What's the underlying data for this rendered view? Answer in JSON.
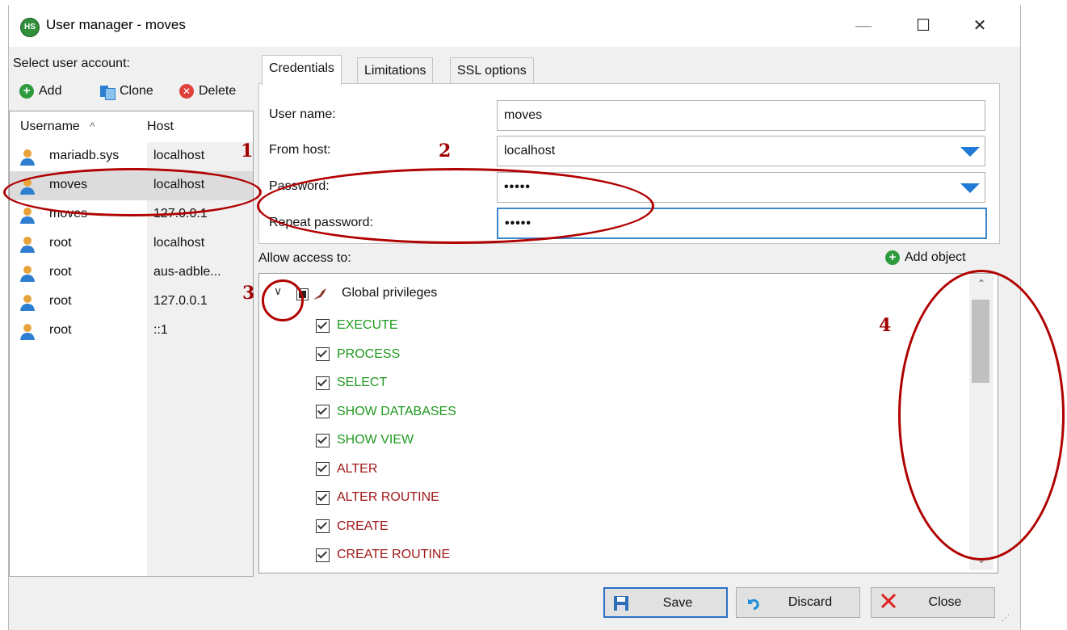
{
  "window": {
    "title": "User manager - moves",
    "app_icon_text": "HS",
    "controls": {
      "minimize": "—",
      "maximize": "☐",
      "close": "✕"
    }
  },
  "left_panel": {
    "label": "Select user account:",
    "toolbar": {
      "add": "Add",
      "clone": "Clone",
      "delete": "Delete"
    },
    "columns": {
      "username": "Username",
      "sort_indicator": "^",
      "host": "Host"
    },
    "users": [
      {
        "username": "mariadb.sys",
        "host": "localhost"
      },
      {
        "username": "moves",
        "host": "localhost"
      },
      {
        "username": "moves",
        "host": "127.0.0.1"
      },
      {
        "username": "root",
        "host": "localhost"
      },
      {
        "username": "root",
        "host": "aus-adble..."
      },
      {
        "username": "root",
        "host": "127.0.0.1"
      },
      {
        "username": "root",
        "host": "::1"
      }
    ],
    "selected_index": 1
  },
  "tabs": [
    "Credentials",
    "Limitations",
    "SSL options"
  ],
  "active_tab": "Credentials",
  "credentials": {
    "user_name_label": "User name:",
    "user_name_value": "moves",
    "from_host_label": "From host:",
    "from_host_value": "localhost",
    "password_label": "Password:",
    "password_value": "•••••",
    "repeat_password_label": "Repeat password:",
    "repeat_password_value": "•••••"
  },
  "access": {
    "label": "Allow access to:",
    "add_object": "Add object",
    "root_node": "Global privileges",
    "privileges": [
      {
        "name": "EXECUTE",
        "color": "#1f9a1f",
        "checked": true
      },
      {
        "name": "PROCESS",
        "color": "#1f9a1f",
        "checked": true
      },
      {
        "name": "SELECT",
        "color": "#1f9a1f",
        "checked": true
      },
      {
        "name": "SHOW DATABASES",
        "color": "#1f9a1f",
        "checked": true
      },
      {
        "name": "SHOW VIEW",
        "color": "#1f9a1f",
        "checked": true
      },
      {
        "name": "ALTER",
        "color": "#a01818",
        "checked": true
      },
      {
        "name": "ALTER ROUTINE",
        "color": "#a01818",
        "checked": true
      },
      {
        "name": "CREATE",
        "color": "#a01818",
        "checked": true
      },
      {
        "name": "CREATE ROUTINE",
        "color": "#a01818",
        "checked": true
      }
    ]
  },
  "buttons": {
    "save": "Save",
    "discard": "Discard",
    "close": "Close"
  },
  "annotations": {
    "n1": "1",
    "n2": "2",
    "n3": "3",
    "n4": "4",
    "color": "#a00000"
  }
}
